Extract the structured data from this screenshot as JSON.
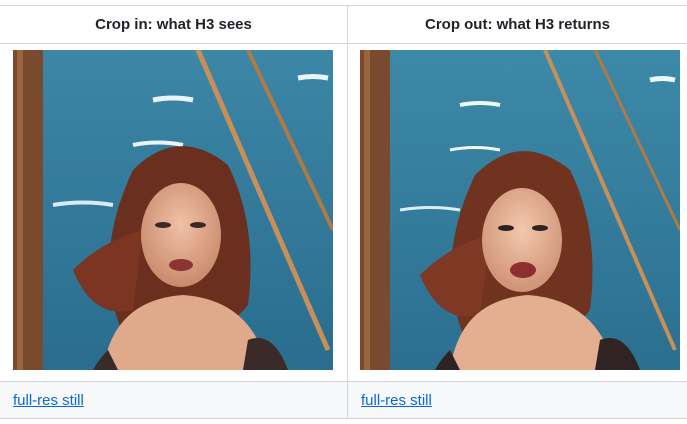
{
  "columns": [
    {
      "header": "Crop in: what H3 sees",
      "image_alt": "cropped still of woman on ship deck, lower resolution",
      "link_label": "full-res still"
    },
    {
      "header": "Crop out: what H3 returns",
      "image_alt": "restored still of woman on ship deck, higher resolution",
      "link_label": "full-res still"
    }
  ],
  "colors": {
    "border": "#d0d7de",
    "link": "#0969da",
    "header_text": "#1f2328",
    "footer_bg": "#f6f8fa"
  }
}
